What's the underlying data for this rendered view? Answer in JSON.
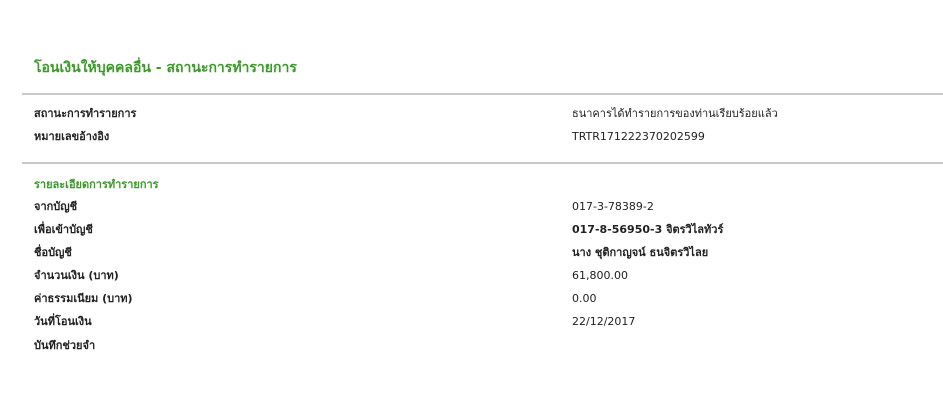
{
  "header": {
    "title": "โอนเงินให้บุคคลอื่น - สถานะการทำรายการ"
  },
  "status": {
    "rows": [
      {
        "label": "สถานะการทำรายการ",
        "value": "ธนาคารได้ทำรายการของท่านเรียบร้อยแล้ว"
      },
      {
        "label": "หมายเลขอ้างอิง",
        "value": "TRTR171222370202599"
      }
    ]
  },
  "details": {
    "heading": "รายละเอียดการทำรายการ",
    "rows": [
      {
        "label": "จากบัญชี",
        "value": "017-3-78389-2"
      },
      {
        "label": "เพื่อเข้าบัญชี",
        "value": "017-8-56950-3 จิตรวิไลทัวร์"
      },
      {
        "label": "ชื่อบัญชี",
        "value": "นาง ชุติกาญจน์ ธนจิตรวิไลย"
      },
      {
        "label": "จำนวนเงิน (บาท)",
        "value": "61,800.00"
      },
      {
        "label": "ค่าธรรมเนียม (บาท)",
        "value": "0.00"
      },
      {
        "label": "วันที่โอนเงิน",
        "value": "22/12/2017"
      },
      {
        "label": "บันทึกช่วยจำ",
        "value": ""
      }
    ]
  },
  "colors": {
    "accent_green": "#3a9a28",
    "divider_gray": "#c9c9c9",
    "text": "#222222"
  }
}
